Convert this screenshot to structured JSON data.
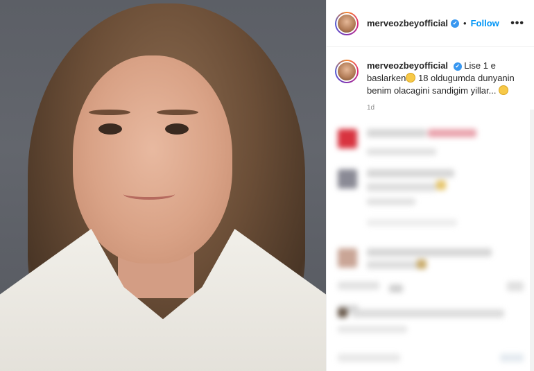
{
  "post": {
    "username": "merveozbeyofficial",
    "verified_mark": "✔",
    "separator": "•",
    "follow_label": "Follow",
    "more_label": "•••"
  },
  "caption": {
    "username": "merveozbeyofficial",
    "text_part1": "Lise 1 e baslarken",
    "text_part2": " 18 oldugumda dunyanin benim olacagini sandigim yillar...",
    "timestamp": "1d"
  },
  "icons": {
    "verified": "verified-badge-icon",
    "more": "more-options-icon",
    "emoji": "emoji-icon"
  },
  "colors": {
    "follow": "#0095f6",
    "verified": "#3897f0"
  }
}
